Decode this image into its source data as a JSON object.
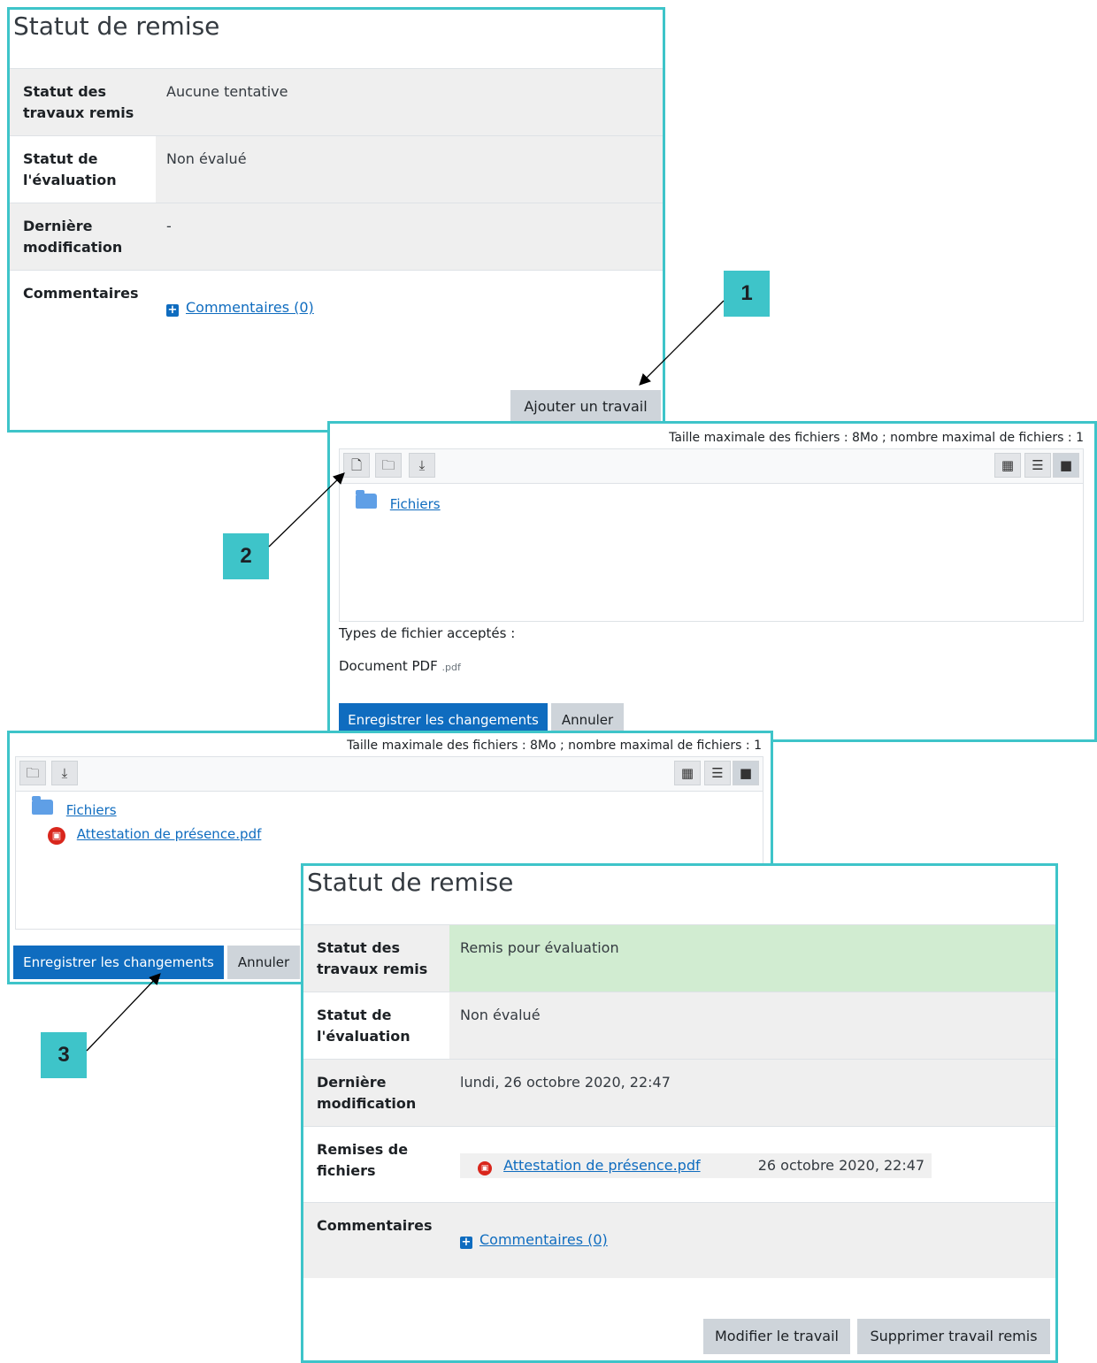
{
  "panel1": {
    "title": "Statut de remise",
    "rows": [
      {
        "label": "Statut des travaux remis",
        "value": "Aucune tentative"
      },
      {
        "label": "Statut de l'évaluation",
        "value": "Non évalué"
      },
      {
        "label": "Dernière modification",
        "value": "-"
      },
      {
        "label": "Commentaires",
        "link": "Commentaires (0)"
      }
    ],
    "add_button": "Ajouter un travail"
  },
  "panel2": {
    "limits": "Taille maximale des fichiers : 8Mo ; nombre maximal de fichiers : 1",
    "folder": "Fichiers",
    "accepted_label": "Types de fichier acceptés :",
    "accepted_type": "Document PDF",
    "accepted_ext": ".pdf",
    "save_button": "Enregistrer les changements",
    "cancel_button": "Annuler"
  },
  "panel3": {
    "limits": "Taille maximale des fichiers : 8Mo ; nombre maximal de fichiers : 1",
    "folder": "Fichiers",
    "file": "Attestation de présence.pdf",
    "save_button": "Enregistrer les changements",
    "cancel_button": "Annuler"
  },
  "panel4": {
    "title": "Statut de remise",
    "rows": [
      {
        "label": "Statut des travaux remis",
        "value": "Remis pour évaluation"
      },
      {
        "label": "Statut de l'évaluation",
        "value": "Non évalué"
      },
      {
        "label": "Dernière modification",
        "value": "lundi, 26 octobre 2020, 22:47"
      },
      {
        "label": "Remises de fichiers",
        "file": "Attestation de présence.pdf",
        "date": "26 octobre 2020, 22:47"
      },
      {
        "label": "Commentaires",
        "link": "Commentaires (0)"
      }
    ],
    "edit_button": "Modifier le travail",
    "delete_button": "Supprimer travail remis"
  },
  "callouts": [
    "1",
    "2",
    "3"
  ],
  "colors": {
    "accent": "#3ec4c9",
    "primary": "#0f6cbf",
    "success_bg": "#d1ecd1"
  }
}
